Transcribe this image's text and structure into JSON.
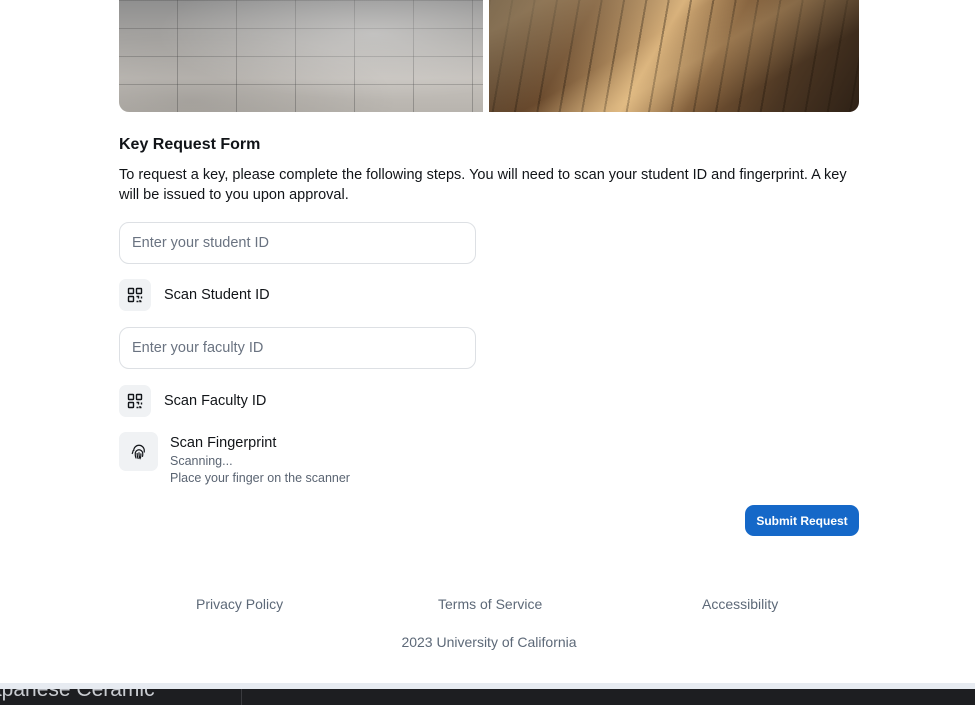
{
  "form": {
    "title": "Key Request Form",
    "intro": "To request a key, please complete the following steps. You will need to scan your student ID and fingerprint. A key will be issued to you upon approval.",
    "student_id_placeholder": "Enter your student ID",
    "scan_student_label": "Scan Student ID",
    "faculty_id_placeholder": "Enter your faculty ID",
    "scan_faculty_label": "Scan Faculty ID",
    "fingerprint": {
      "title": "Scan Fingerprint",
      "status": "Scanning...",
      "hint": "Place your finger on the scanner"
    },
    "submit_label": "Submit Request"
  },
  "footer": {
    "links": [
      "Privacy Policy",
      "Terms of Service",
      "Accessibility"
    ],
    "copyright": "2023 University of California"
  },
  "bottom_bar": {
    "title": "apanese Ceramic"
  },
  "colors": {
    "accent": "#1568c8",
    "muted_text": "#5d6978",
    "tile_bg": "#f0f2f4"
  }
}
